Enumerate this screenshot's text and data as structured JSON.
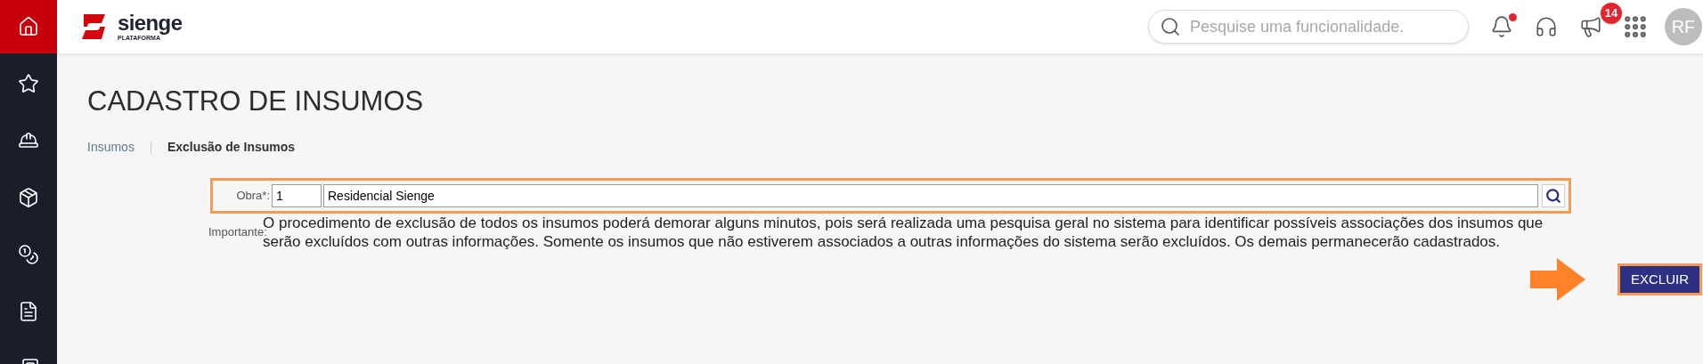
{
  "header": {
    "logo": {
      "name": "sienge",
      "subtitle": "PLATAFORMA"
    },
    "search": {
      "placeholder": "Pesquise uma funcionalidade."
    },
    "notifications": {
      "unread": true
    },
    "announcements": {
      "badge": "14"
    },
    "avatar": "RF"
  },
  "sidebar": {
    "items": [
      {
        "selected": true
      },
      {
        "selected": false
      },
      {
        "selected": false
      },
      {
        "selected": false
      },
      {
        "selected": false
      },
      {
        "selected": false
      },
      {
        "selected": false
      }
    ]
  },
  "page": {
    "title": "CADASTRO DE INSUMOS",
    "breadcrumb": [
      {
        "label": "Insumos",
        "current": false
      },
      {
        "label": "Exclusão de Insumos",
        "current": true
      }
    ]
  },
  "form": {
    "obra": {
      "label": "Obra*:",
      "code": "1",
      "name": "Residencial Sienge"
    },
    "important": {
      "label": "Importante:",
      "text": "O procedimento de exclusão de todos os insumos poderá demorar alguns minutos, pois será realizada uma pesquisa geral no sistema para identificar possíveis associações dos insumos que serão excluídos com outras informações. Somente os insumos que não estiverem associados a outras informações do sistema serão excluídos. Os demais permanecerão cadastrados."
    },
    "button": "EXCLUIR"
  }
}
